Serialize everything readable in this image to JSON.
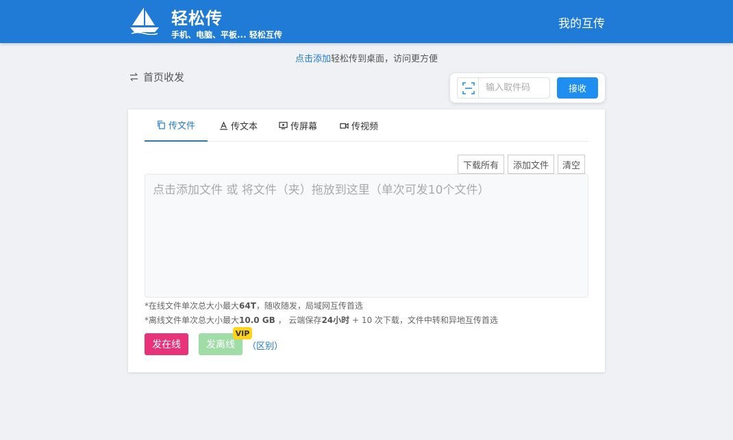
{
  "header": {
    "brand_title": "轻松传",
    "brand_subtitle": "手机、电脑、平板... 轻松互传",
    "nav_my_transfer": "我的互传",
    "logo_icon": "sailboat-icon"
  },
  "hint": {
    "link_text": "点击添加",
    "rest_text": "轻松传到桌面，访问更方便"
  },
  "breadcrumb": {
    "label": "首页收发",
    "icon": "swap-arrows-icon"
  },
  "receive": {
    "scan_icon": "scan-icon",
    "input_placeholder": "输入取件码",
    "input_value": "",
    "button_label": "接收"
  },
  "tabs": [
    {
      "label": "传文件",
      "icon": "copy-icon",
      "active": true
    },
    {
      "label": "传文本",
      "icon": "text-icon",
      "active": false
    },
    {
      "label": "传屏幕",
      "icon": "monitor-icon",
      "active": false
    },
    {
      "label": "传视频",
      "icon": "video-icon",
      "active": false
    }
  ],
  "actions": {
    "download_all": "下载所有",
    "add_file": "添加文件",
    "clear": "清空"
  },
  "dropzone": {
    "placeholder": "点击添加文件 或 将文件（夹）拖放到这里（单次可发10个文件）"
  },
  "notes": {
    "online_prefix": "*在线文件单次总大小最大",
    "online_size": "64T",
    "online_suffix": "，随收随发，局域网互传首选",
    "offline_prefix": "*离线文件单次总大小最大",
    "offline_size": "10.0 GB",
    "offline_mid": " ， 云端保存",
    "offline_hours": "24小时",
    "offline_suffix": " + 10 次下载，文件中转和异地互传首选"
  },
  "send": {
    "online_label": "发在线",
    "offline_label": "发离线",
    "vip_badge": "VIP",
    "diff_link": "（区别）"
  },
  "colors": {
    "header_bg": "#1f7bd6",
    "primary": "#1e8ff0",
    "online_btn": "#e8337a",
    "offline_btn": "#9fdca6",
    "vip": "#ffd319"
  }
}
